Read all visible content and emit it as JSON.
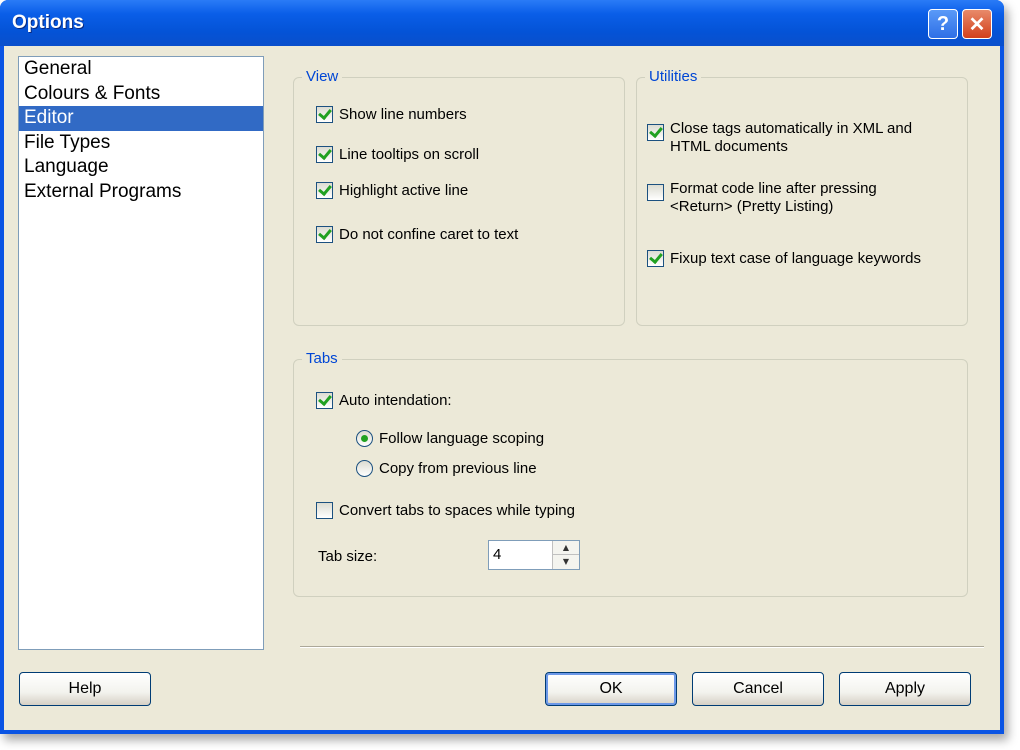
{
  "window": {
    "title": "Options",
    "help_glyph": "?",
    "close_glyph": "✕"
  },
  "nav": {
    "items": [
      {
        "label": "General",
        "selected": false
      },
      {
        "label": "Colours & Fonts",
        "selected": false
      },
      {
        "label": "Editor",
        "selected": true
      },
      {
        "label": "File Types",
        "selected": false
      },
      {
        "label": "Language",
        "selected": false
      },
      {
        "label": "External Programs",
        "selected": false
      }
    ]
  },
  "view": {
    "legend": "View",
    "show_line_numbers": {
      "label": "Show line numbers",
      "checked": true
    },
    "line_tooltips": {
      "label": "Line tooltips on scroll",
      "checked": true
    },
    "highlight_active": {
      "label": "Highlight active line",
      "checked": true
    },
    "confine_caret": {
      "label": "Do not confine caret to text",
      "checked": true
    }
  },
  "utilities": {
    "legend": "Utilities",
    "close_tags": {
      "label_line1": "Close tags automatically in XML and",
      "label_line2": "HTML documents",
      "checked": true
    },
    "format_code": {
      "label_line1": "Format code line after pressing",
      "label_line2": "<Return> (Pretty Listing)",
      "checked": false
    },
    "fixup_case": {
      "label": "Fixup text case of language keywords",
      "checked": true
    }
  },
  "tabs": {
    "legend": "Tabs",
    "auto_indent": {
      "label": "Auto intendation:",
      "checked": true
    },
    "follow_scoping": {
      "label": "Follow language scoping",
      "selected": true
    },
    "copy_previous": {
      "label": "Copy from previous line",
      "selected": false
    },
    "convert_tabs": {
      "label": "Convert tabs to spaces while typing",
      "checked": false
    },
    "tab_size_label": "Tab size:",
    "tab_size_value": "4"
  },
  "buttons": {
    "help": "Help",
    "ok": "OK",
    "cancel": "Cancel",
    "apply": "Apply"
  },
  "colors": {
    "title_bar": "#0a5ee8",
    "dialog_bg": "#ece9d8",
    "selection": "#316ac5",
    "group_label": "#0046d5",
    "check": "#21a121"
  },
  "icons": {
    "help": "question-mark-icon",
    "close": "x-icon",
    "spin_up": "triangle-up-icon",
    "spin_down": "triangle-down-icon"
  }
}
